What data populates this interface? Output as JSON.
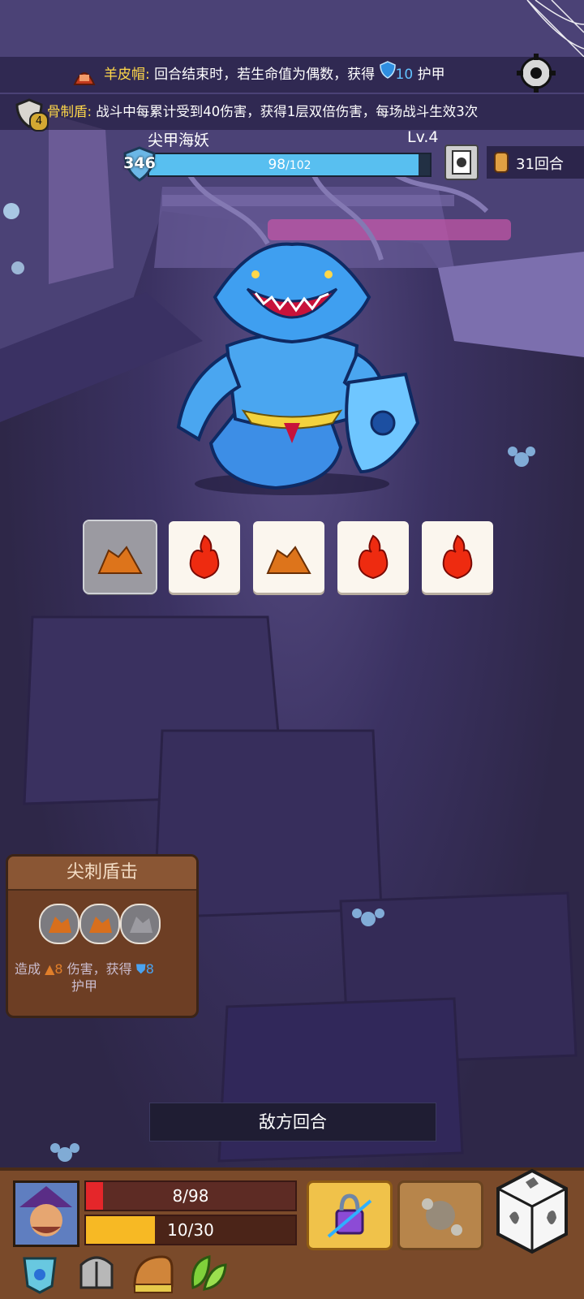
{
  "abilities": [
    {
      "name": "羊皮帽",
      "colon": ":",
      "text_before": " 回合结束时，若生命值为偶数，获得 ",
      "value": "10",
      "text_after": " 护甲"
    },
    {
      "name": "骨制盾",
      "colon": ":",
      "text": " 战斗中每累计受到40伤害，获得1层双倍伤害，每场战斗生效3次",
      "badge": "4"
    }
  ],
  "enemy": {
    "name": "尖甲海妖",
    "level": "Lv.4",
    "shield": "346",
    "hp_current": "98",
    "hp_max": "/102",
    "hp_fraction": 0.96
  },
  "turn_counter": "31回合",
  "dice": [
    {
      "face": "rock",
      "selected": true
    },
    {
      "face": "fire",
      "selected": false
    },
    {
      "face": "rock",
      "selected": false
    },
    {
      "face": "fire",
      "selected": false
    },
    {
      "face": "fire",
      "selected": false
    }
  ],
  "skill_card": {
    "title": "尖刺盾击",
    "slots": [
      "rock",
      "rock",
      "rock-grey"
    ],
    "desc_before": "造成 ",
    "damage": "8",
    "desc_mid": " 伤害，获得 ",
    "armor": "8",
    "desc_after": "护甲"
  },
  "turn_banner": "敌方回合",
  "player": {
    "hp": "8/98",
    "hp_fraction": 0.08,
    "energy": "10/30",
    "energy_fraction": 0.33
  },
  "colors": {
    "hp_bar": "#58bff0",
    "player_hp": "#e5262a",
    "player_energy": "#f7b924",
    "accent_yellow": "#ffd84a"
  },
  "icons": [
    "armor-icon",
    "helmet-icon",
    "scroll-icon",
    "leaf-icon"
  ]
}
